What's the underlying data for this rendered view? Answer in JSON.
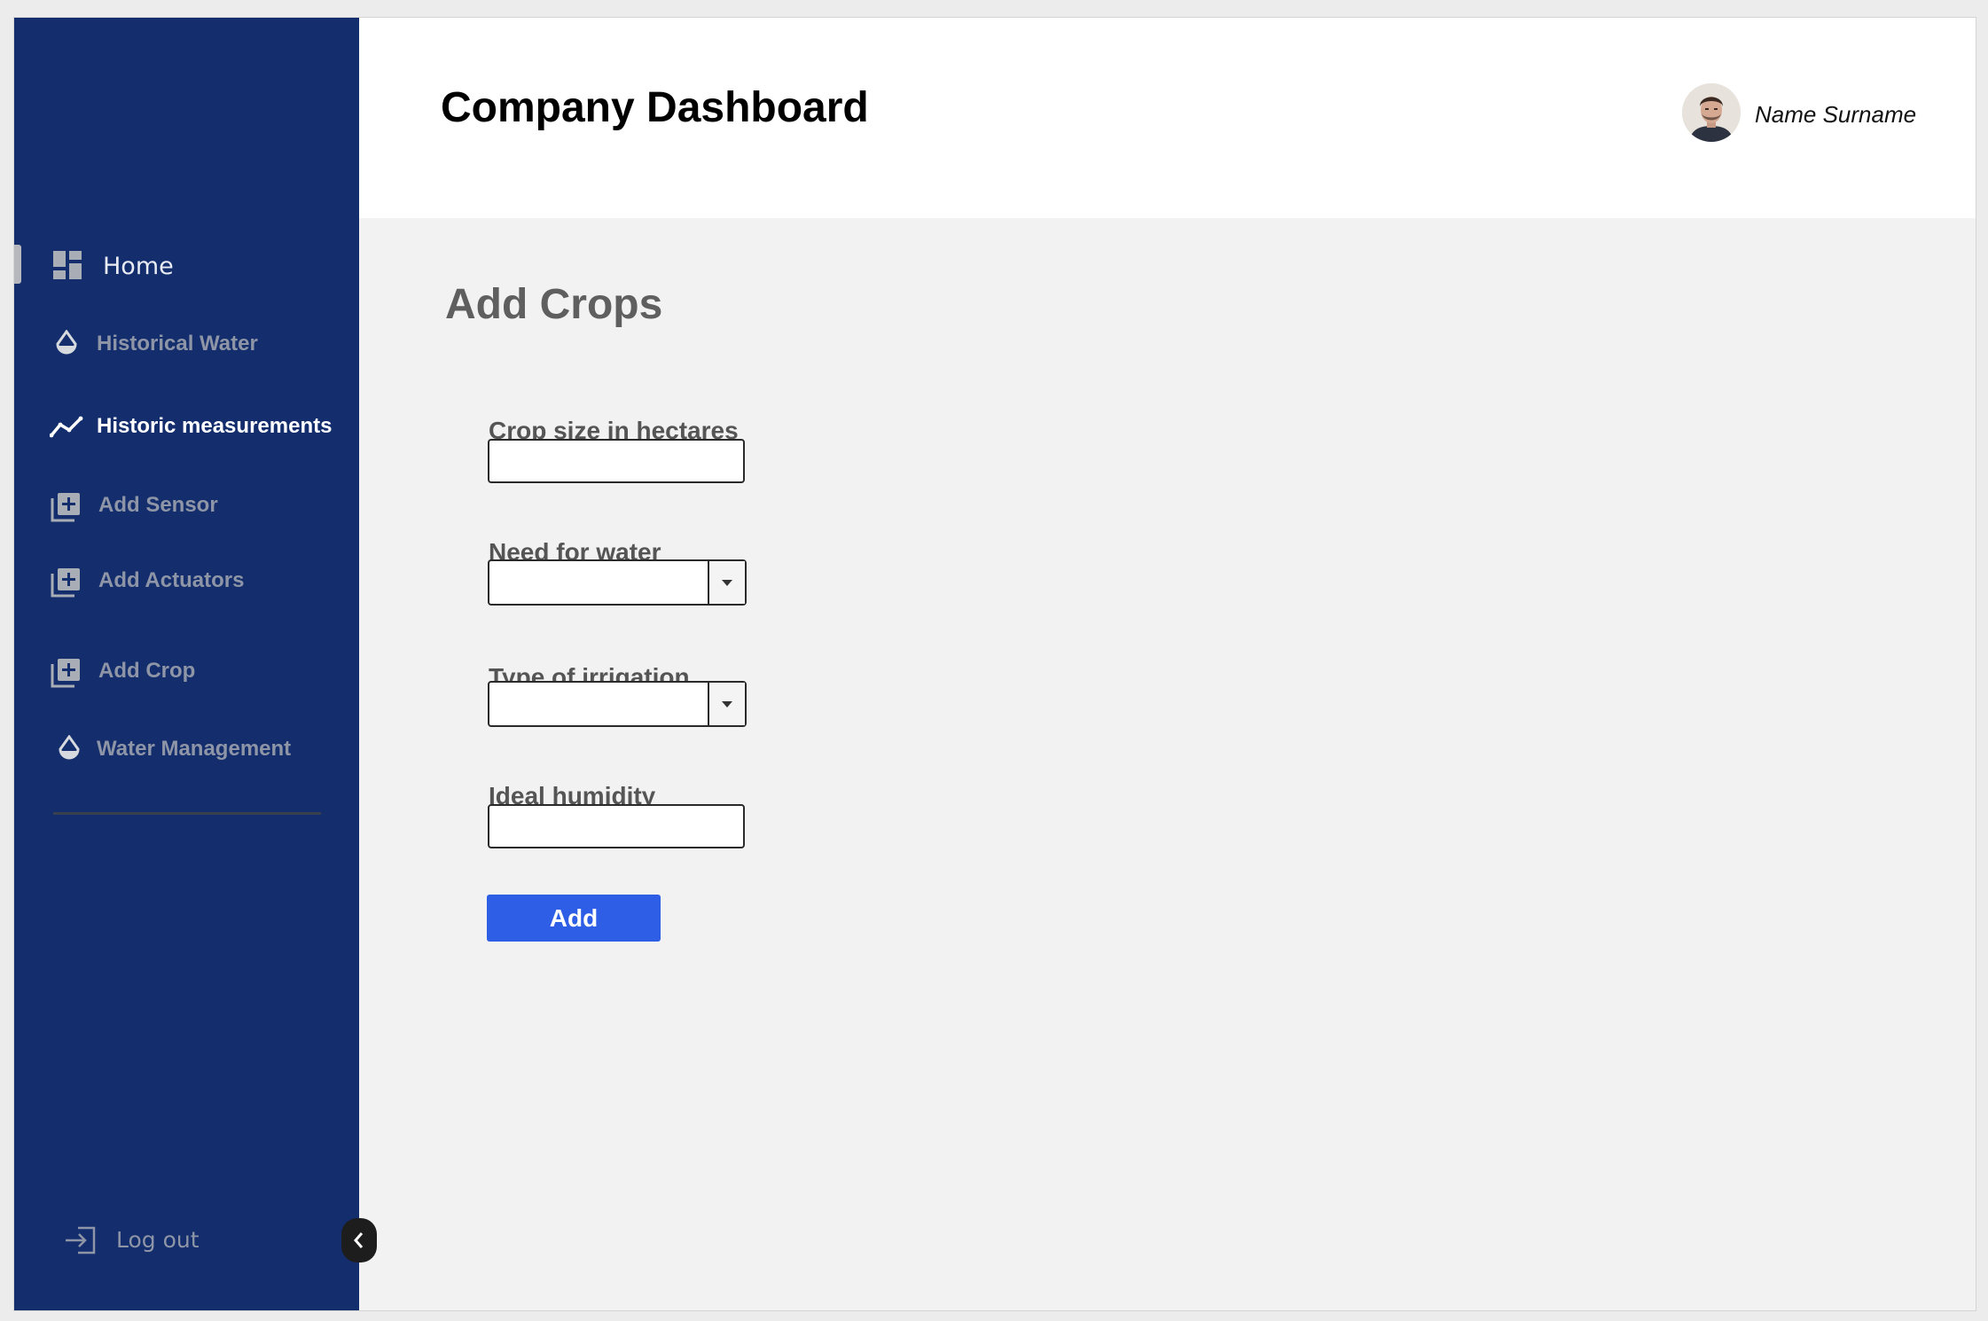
{
  "header": {
    "title": "Company Dashboard",
    "user_name": "Name Surname"
  },
  "sidebar": {
    "items": [
      {
        "label": "Home",
        "icon": "dashboard-icon"
      },
      {
        "label": "Historical Water",
        "icon": "water-drop-icon"
      },
      {
        "label": "Historic measurements",
        "icon": "trend-line-icon"
      },
      {
        "label": "Add Sensor",
        "icon": "add-box-icon"
      },
      {
        "label": "Add Actuators",
        "icon": "add-box-icon"
      },
      {
        "label": "Add Crop",
        "icon": "add-box-icon"
      },
      {
        "label": "Water Management",
        "icon": "water-drop-icon"
      }
    ],
    "logout_label": "Log out"
  },
  "form": {
    "heading": "Add Crops",
    "crop_size_label": "Crop size in hectares",
    "crop_size_value": "",
    "water_need_label": "Need for water",
    "water_need_value": "",
    "irrigation_label": "Type of irrigation",
    "irrigation_value": "",
    "humidity_label": "Ideal humidity",
    "humidity_value": "",
    "submit_label": "Add"
  },
  "colors": {
    "sidebar": "#132d6d",
    "accent": "#2e5ee6",
    "content_bg": "#f2f2f2"
  }
}
